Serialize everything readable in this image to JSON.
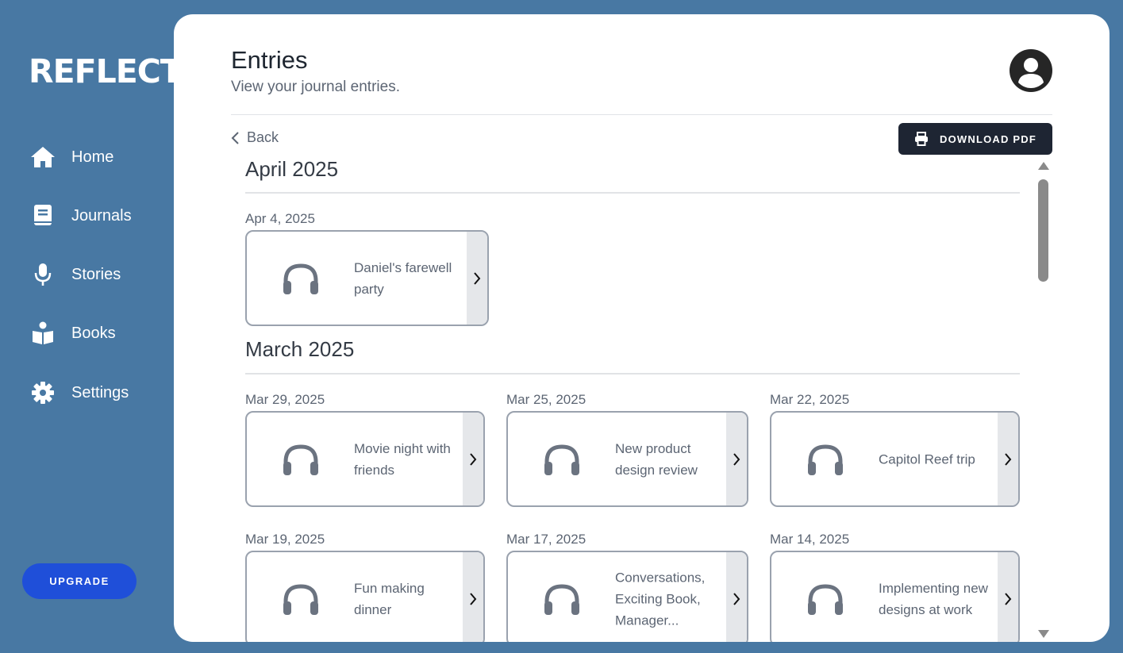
{
  "app": {
    "logo": "REFLECT"
  },
  "sidebar": {
    "items": [
      {
        "label": "Home",
        "icon": "home-icon"
      },
      {
        "label": "Journals",
        "icon": "journal-book-icon"
      },
      {
        "label": "Stories",
        "icon": "microphone-icon"
      },
      {
        "label": "Books",
        "icon": "reader-book-icon"
      },
      {
        "label": "Settings",
        "icon": "gear-icon"
      }
    ],
    "upgrade_label": "UPGRADE"
  },
  "header": {
    "title": "Entries",
    "subtitle": "View your journal entries."
  },
  "toolbar": {
    "back_label": "Back",
    "download_label": "DOWNLOAD PDF"
  },
  "sections": [
    {
      "title": "April 2025",
      "entries": [
        {
          "date": "Apr 4, 2025",
          "title": "Daniel's farewell party"
        }
      ]
    },
    {
      "title": "March 2025",
      "entries": [
        {
          "date": "Mar 29, 2025",
          "title": "Movie night with friends"
        },
        {
          "date": "Mar 25, 2025",
          "title": "New product design review"
        },
        {
          "date": "Mar 22, 2025",
          "title": "Capitol Reef trip"
        },
        {
          "date": "Mar 19, 2025",
          "title": "Fun making dinner"
        },
        {
          "date": "Mar 17, 2025",
          "title": "Conversations, Exciting Book, Manager..."
        },
        {
          "date": "Mar 14, 2025",
          "title": "Implementing new designs at work"
        }
      ]
    }
  ],
  "colors": {
    "sidebar_bg": "#4878a3",
    "upgrade_button": "#1f4fd9",
    "download_button": "#1e2533",
    "card_border": "#9aa2ae"
  }
}
